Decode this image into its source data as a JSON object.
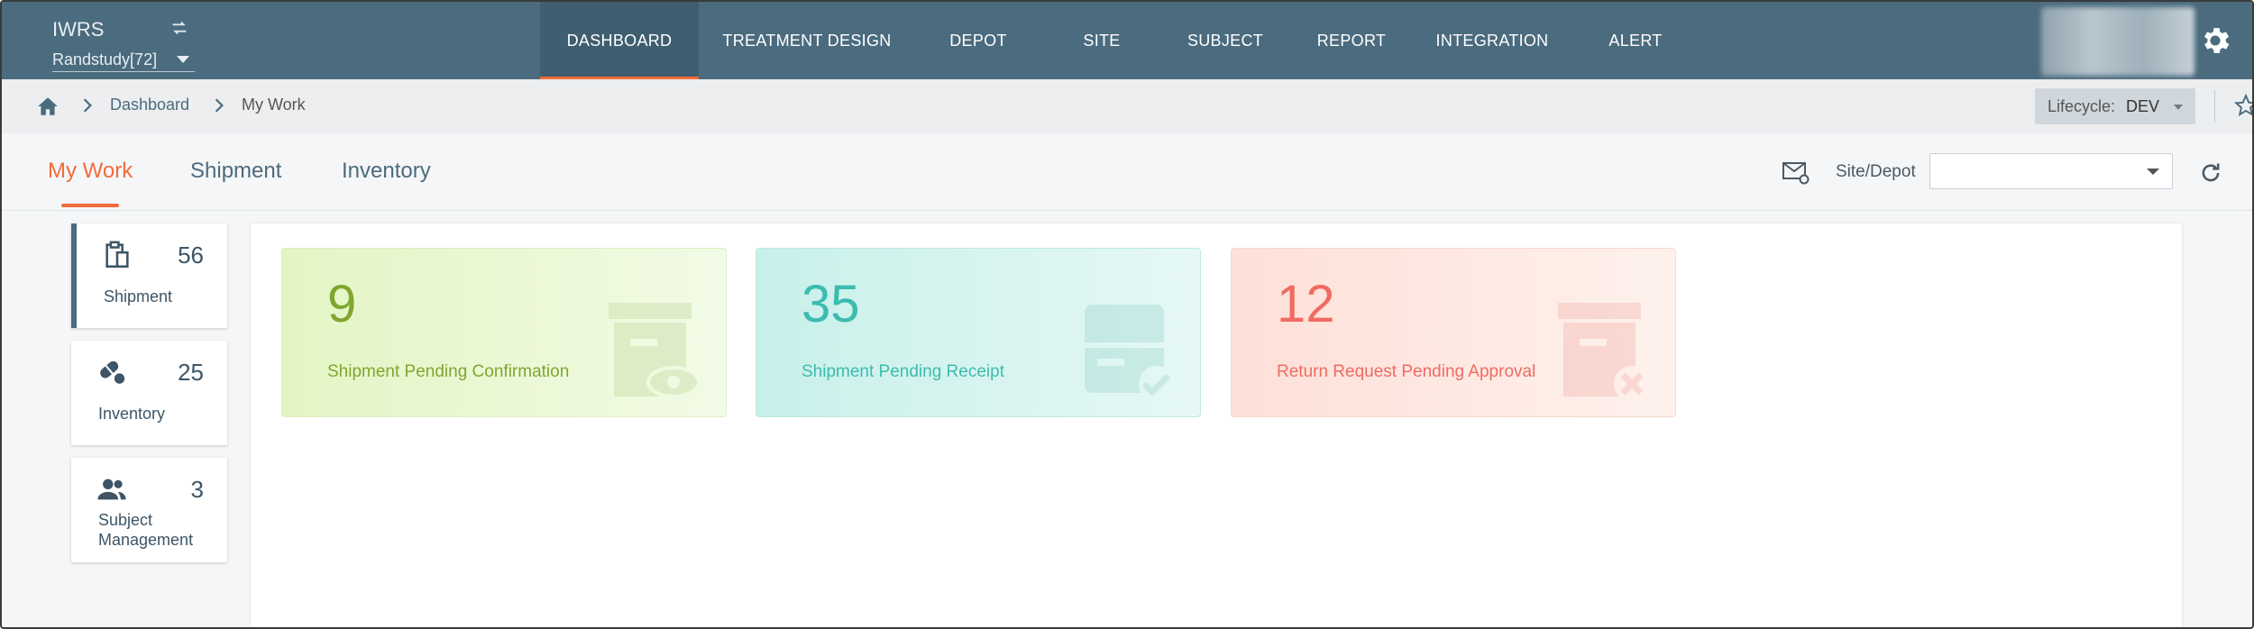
{
  "header": {
    "app_title": "IWRS",
    "study": "Randstudy[72]",
    "nav": [
      {
        "label": "DASHBOARD",
        "active": true
      },
      {
        "label": "TREATMENT DESIGN",
        "active": false
      },
      {
        "label": "DEPOT",
        "active": false
      },
      {
        "label": "SITE",
        "active": false
      },
      {
        "label": "SUBJECT",
        "active": false
      },
      {
        "label": "REPORT",
        "active": false
      },
      {
        "label": "INTEGRATION",
        "active": false
      },
      {
        "label": "ALERT",
        "active": false
      }
    ]
  },
  "breadcrumb": {
    "items": [
      "Dashboard",
      "My Work"
    ]
  },
  "lifecycle": {
    "label": "Lifecycle:",
    "value": "DEV"
  },
  "tabs": [
    {
      "label": "My Work",
      "active": true
    },
    {
      "label": "Shipment",
      "active": false
    },
    {
      "label": "Inventory",
      "active": false
    }
  ],
  "filter": {
    "site_label": "Site/Depot",
    "site_value": ""
  },
  "sidebar": [
    {
      "label": "Shipment",
      "count": "56",
      "icon": "clipboard-icon",
      "active": true
    },
    {
      "label": "Inventory",
      "count": "25",
      "icon": "pills-icon",
      "active": false
    },
    {
      "label": "Subject\nManagement",
      "count": "3",
      "icon": "people-icon",
      "active": false
    }
  ],
  "stats": [
    {
      "value": "9",
      "label": "Shipment Pending Confirmation",
      "color": "#7fa62e",
      "icon": "box-eye-icon"
    },
    {
      "value": "35",
      "label": "Shipment Pending Receipt",
      "color": "#3bbcae",
      "icon": "box-check-icon"
    },
    {
      "value": "12",
      "label": "Return Request Pending Approval",
      "color": "#f06b62",
      "icon": "box-x-icon"
    }
  ],
  "colors": {
    "topbar": "#4b6b7e",
    "accent": "#f26b3a"
  }
}
